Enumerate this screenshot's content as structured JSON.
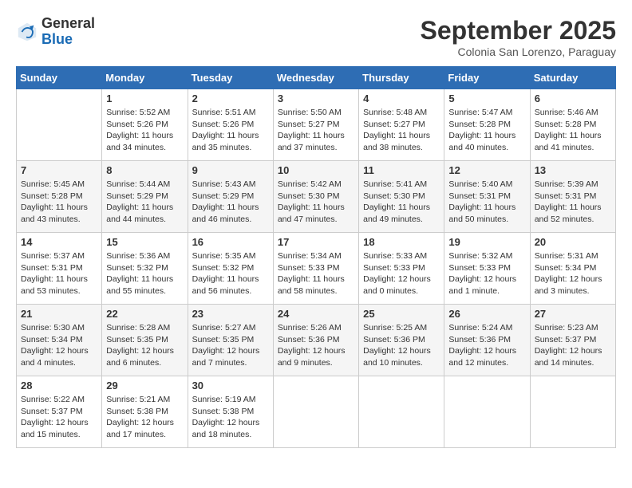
{
  "logo": {
    "line1": "General",
    "line2": "Blue"
  },
  "title": "September 2025",
  "subtitle": "Colonia San Lorenzo, Paraguay",
  "days": [
    "Sunday",
    "Monday",
    "Tuesday",
    "Wednesday",
    "Thursday",
    "Friday",
    "Saturday"
  ],
  "weeks": [
    [
      {
        "day": "",
        "sunrise": "",
        "sunset": "",
        "daylight": ""
      },
      {
        "day": "1",
        "sunrise": "Sunrise: 5:52 AM",
        "sunset": "Sunset: 5:26 PM",
        "daylight": "Daylight: 11 hours and 34 minutes."
      },
      {
        "day": "2",
        "sunrise": "Sunrise: 5:51 AM",
        "sunset": "Sunset: 5:26 PM",
        "daylight": "Daylight: 11 hours and 35 minutes."
      },
      {
        "day": "3",
        "sunrise": "Sunrise: 5:50 AM",
        "sunset": "Sunset: 5:27 PM",
        "daylight": "Daylight: 11 hours and 37 minutes."
      },
      {
        "day": "4",
        "sunrise": "Sunrise: 5:48 AM",
        "sunset": "Sunset: 5:27 PM",
        "daylight": "Daylight: 11 hours and 38 minutes."
      },
      {
        "day": "5",
        "sunrise": "Sunrise: 5:47 AM",
        "sunset": "Sunset: 5:28 PM",
        "daylight": "Daylight: 11 hours and 40 minutes."
      },
      {
        "day": "6",
        "sunrise": "Sunrise: 5:46 AM",
        "sunset": "Sunset: 5:28 PM",
        "daylight": "Daylight: 11 hours and 41 minutes."
      }
    ],
    [
      {
        "day": "7",
        "sunrise": "Sunrise: 5:45 AM",
        "sunset": "Sunset: 5:28 PM",
        "daylight": "Daylight: 11 hours and 43 minutes."
      },
      {
        "day": "8",
        "sunrise": "Sunrise: 5:44 AM",
        "sunset": "Sunset: 5:29 PM",
        "daylight": "Daylight: 11 hours and 44 minutes."
      },
      {
        "day": "9",
        "sunrise": "Sunrise: 5:43 AM",
        "sunset": "Sunset: 5:29 PM",
        "daylight": "Daylight: 11 hours and 46 minutes."
      },
      {
        "day": "10",
        "sunrise": "Sunrise: 5:42 AM",
        "sunset": "Sunset: 5:30 PM",
        "daylight": "Daylight: 11 hours and 47 minutes."
      },
      {
        "day": "11",
        "sunrise": "Sunrise: 5:41 AM",
        "sunset": "Sunset: 5:30 PM",
        "daylight": "Daylight: 11 hours and 49 minutes."
      },
      {
        "day": "12",
        "sunrise": "Sunrise: 5:40 AM",
        "sunset": "Sunset: 5:31 PM",
        "daylight": "Daylight: 11 hours and 50 minutes."
      },
      {
        "day": "13",
        "sunrise": "Sunrise: 5:39 AM",
        "sunset": "Sunset: 5:31 PM",
        "daylight": "Daylight: 11 hours and 52 minutes."
      }
    ],
    [
      {
        "day": "14",
        "sunrise": "Sunrise: 5:37 AM",
        "sunset": "Sunset: 5:31 PM",
        "daylight": "Daylight: 11 hours and 53 minutes."
      },
      {
        "day": "15",
        "sunrise": "Sunrise: 5:36 AM",
        "sunset": "Sunset: 5:32 PM",
        "daylight": "Daylight: 11 hours and 55 minutes."
      },
      {
        "day": "16",
        "sunrise": "Sunrise: 5:35 AM",
        "sunset": "Sunset: 5:32 PM",
        "daylight": "Daylight: 11 hours and 56 minutes."
      },
      {
        "day": "17",
        "sunrise": "Sunrise: 5:34 AM",
        "sunset": "Sunset: 5:33 PM",
        "daylight": "Daylight: 11 hours and 58 minutes."
      },
      {
        "day": "18",
        "sunrise": "Sunrise: 5:33 AM",
        "sunset": "Sunset: 5:33 PM",
        "daylight": "Daylight: 12 hours and 0 minutes."
      },
      {
        "day": "19",
        "sunrise": "Sunrise: 5:32 AM",
        "sunset": "Sunset: 5:33 PM",
        "daylight": "Daylight: 12 hours and 1 minute."
      },
      {
        "day": "20",
        "sunrise": "Sunrise: 5:31 AM",
        "sunset": "Sunset: 5:34 PM",
        "daylight": "Daylight: 12 hours and 3 minutes."
      }
    ],
    [
      {
        "day": "21",
        "sunrise": "Sunrise: 5:30 AM",
        "sunset": "Sunset: 5:34 PM",
        "daylight": "Daylight: 12 hours and 4 minutes."
      },
      {
        "day": "22",
        "sunrise": "Sunrise: 5:28 AM",
        "sunset": "Sunset: 5:35 PM",
        "daylight": "Daylight: 12 hours and 6 minutes."
      },
      {
        "day": "23",
        "sunrise": "Sunrise: 5:27 AM",
        "sunset": "Sunset: 5:35 PM",
        "daylight": "Daylight: 12 hours and 7 minutes."
      },
      {
        "day": "24",
        "sunrise": "Sunrise: 5:26 AM",
        "sunset": "Sunset: 5:36 PM",
        "daylight": "Daylight: 12 hours and 9 minutes."
      },
      {
        "day": "25",
        "sunrise": "Sunrise: 5:25 AM",
        "sunset": "Sunset: 5:36 PM",
        "daylight": "Daylight: 12 hours and 10 minutes."
      },
      {
        "day": "26",
        "sunrise": "Sunrise: 5:24 AM",
        "sunset": "Sunset: 5:36 PM",
        "daylight": "Daylight: 12 hours and 12 minutes."
      },
      {
        "day": "27",
        "sunrise": "Sunrise: 5:23 AM",
        "sunset": "Sunset: 5:37 PM",
        "daylight": "Daylight: 12 hours and 14 minutes."
      }
    ],
    [
      {
        "day": "28",
        "sunrise": "Sunrise: 5:22 AM",
        "sunset": "Sunset: 5:37 PM",
        "daylight": "Daylight: 12 hours and 15 minutes."
      },
      {
        "day": "29",
        "sunrise": "Sunrise: 5:21 AM",
        "sunset": "Sunset: 5:38 PM",
        "daylight": "Daylight: 12 hours and 17 minutes."
      },
      {
        "day": "30",
        "sunrise": "Sunrise: 5:19 AM",
        "sunset": "Sunset: 5:38 PM",
        "daylight": "Daylight: 12 hours and 18 minutes."
      },
      {
        "day": "",
        "sunrise": "",
        "sunset": "",
        "daylight": ""
      },
      {
        "day": "",
        "sunrise": "",
        "sunset": "",
        "daylight": ""
      },
      {
        "day": "",
        "sunrise": "",
        "sunset": "",
        "daylight": ""
      },
      {
        "day": "",
        "sunrise": "",
        "sunset": "",
        "daylight": ""
      }
    ]
  ]
}
